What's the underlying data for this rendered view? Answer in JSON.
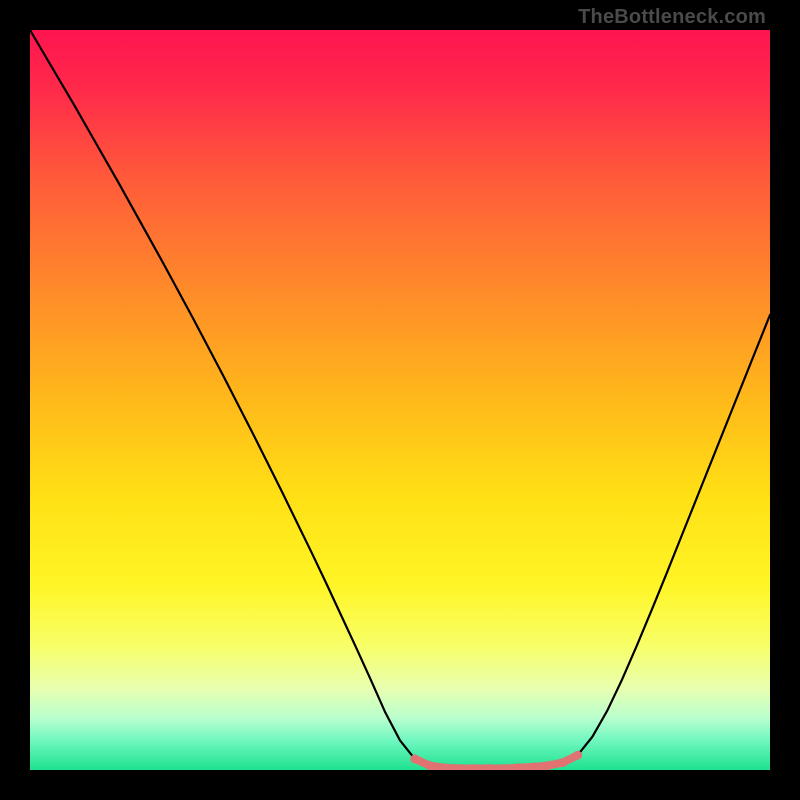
{
  "watermark": "TheBottleneck.com",
  "colors": {
    "curve": "#000000",
    "marker": "#e07272",
    "gradient_top": "#ff1450",
    "gradient_bottom": "#1de28f"
  },
  "chart_data": {
    "type": "line",
    "title": "",
    "xlabel": "",
    "ylabel": "",
    "xlim": [
      0,
      100
    ],
    "ylim": [
      0,
      100
    ],
    "x": [
      0,
      2,
      4,
      6,
      8,
      10,
      12,
      14,
      16,
      18,
      20,
      22,
      24,
      26,
      28,
      30,
      32,
      34,
      36,
      38,
      40,
      42,
      44,
      46,
      48,
      50,
      52,
      54,
      56,
      58,
      60,
      62,
      64,
      66,
      68,
      70,
      72,
      74,
      76,
      78,
      80,
      82,
      84,
      86,
      88,
      90,
      92,
      94,
      96,
      98,
      100
    ],
    "values": [
      100,
      96.6,
      93.2,
      89.8,
      86.3,
      82.8,
      79.3,
      75.7,
      72.1,
      68.5,
      64.8,
      61.1,
      57.3,
      53.5,
      49.6,
      45.7,
      41.7,
      37.7,
      33.6,
      29.5,
      25.3,
      21.0,
      16.7,
      12.3,
      7.8,
      4.0,
      1.5,
      0.4,
      0.1,
      0.0,
      0.0,
      0.0,
      0.0,
      0.0,
      0.1,
      0.3,
      0.8,
      2.0,
      4.5,
      8.0,
      12.2,
      16.8,
      21.6,
      26.5,
      31.5,
      36.5,
      41.5,
      46.5,
      51.5,
      56.5,
      61.5
    ],
    "markers_x": [
      52,
      54,
      56,
      58,
      60,
      62,
      64,
      66,
      68,
      70,
      72,
      74
    ],
    "markers_y": [
      1.5,
      0.6,
      0.3,
      0.2,
      0.2,
      0.2,
      0.2,
      0.3,
      0.4,
      0.6,
      1.0,
      2.0
    ],
    "marker_radius": 4.5
  }
}
